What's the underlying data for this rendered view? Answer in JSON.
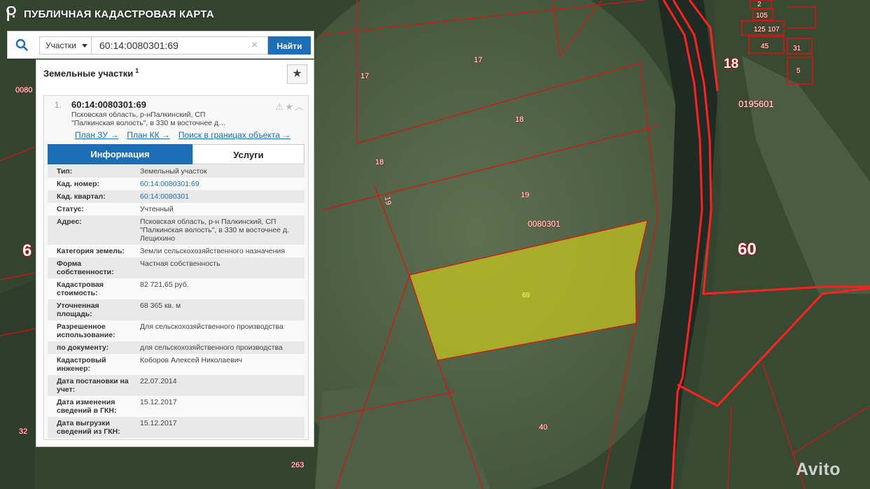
{
  "app": {
    "title": "ПУБЛИЧНАЯ КАДАСТРОВАЯ КАРТА",
    "logo_icon": "rosreestr-logo-icon"
  },
  "search": {
    "type_selected": "Участки",
    "query": "60:14:0080301:69",
    "find_label": "Найти",
    "clear_symbol": "×"
  },
  "results": {
    "header": "Земельные участки",
    "count": "1",
    "favorite_symbol": "★",
    "card": {
      "index": "1.",
      "number": "60:14:0080301:69",
      "address_line1": "Псковская область, р-нПалкинский, СП",
      "address_line2": "\"Палкинская волость\", в 330 м восточнее д…",
      "links": [
        "План ЗУ →",
        "План КК →",
        "Поиск в границах объекта →"
      ],
      "tabs": [
        "Информация",
        "Услуги"
      ],
      "rows": [
        {
          "key": "Тип:",
          "value": "Земельный участок"
        },
        {
          "key": "Кад. номер:",
          "value": "60:14:0080301:69",
          "link": true
        },
        {
          "key": "Кад. квартал:",
          "value": "60:14:0080301",
          "link": true
        },
        {
          "key": "Статус:",
          "value": "Учтенный"
        },
        {
          "key": "Адрес:",
          "value": "Псковская область, р-н Палкинский, СП \"Палкинская волость\", в 330 м восточнее д. Лещихино"
        },
        {
          "key": "Категория земель:",
          "value": "Земли сельскохозяйственного назначения"
        },
        {
          "key": "Форма собственности:",
          "value": "Частная собственность"
        },
        {
          "key": "Кадастровая стоимость:",
          "value": "82 721,65 руб."
        },
        {
          "key": "Уточненная площадь:",
          "value": "68 365 кв. м"
        },
        {
          "key": "Разрешенное использование:",
          "value": "Для сельскохозяйственного производства"
        },
        {
          "key": "по документу:",
          "value": "для сельскохозяйственного производства"
        },
        {
          "key": "Кадастровый инженер:",
          "value": "Коборов Алексей Николаевич"
        },
        {
          "key": "Дата постановки на учет:",
          "value": "22.07.2014"
        },
        {
          "key": "Дата изменения сведений в ГКН:",
          "value": "15.12.2017"
        },
        {
          "key": "Дата выгрузки сведений из ГКН:",
          "value": "15.12.2017"
        }
      ]
    }
  },
  "map": {
    "highlight_color": "#c8c81e",
    "boundary_color": "#e01010",
    "labels": [
      "17",
      "17",
      "18",
      "18",
      "19",
      "19",
      "0080301",
      "69",
      "40",
      "263",
      "32",
      "0080",
      "6",
      "18",
      "60",
      "0195601",
      "2",
      "105",
      "125",
      "107",
      "45",
      "31",
      "5"
    ]
  },
  "watermark": "Avito"
}
